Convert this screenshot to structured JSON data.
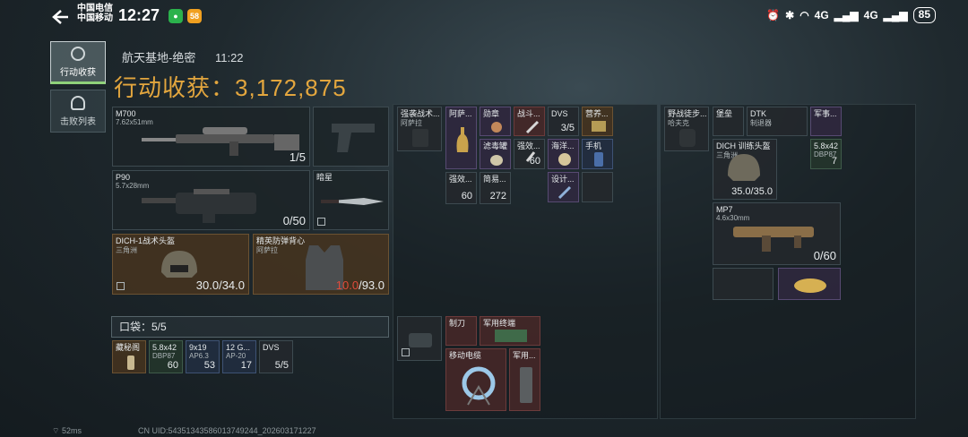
{
  "status": {
    "carrier_line1": "中国电信",
    "carrier_line2": "中国移动",
    "time": "12:27",
    "app_badge": "58",
    "network1": "4G",
    "network2": "4G",
    "battery": "85"
  },
  "nav": [
    {
      "label": "行动收获",
      "active": true
    },
    {
      "label": "击败列表",
      "active": false
    }
  ],
  "location": {
    "map": "航天基地-绝密",
    "duration": "11:22"
  },
  "headline": {
    "label": "行动收获：",
    "value": "3,172,875"
  },
  "weapons": [
    {
      "name": "M700",
      "caliber": "7.62x51mm",
      "count": "1/5"
    },
    {
      "name": "",
      "caliber": "",
      "count": ""
    },
    {
      "name": "P90",
      "caliber": "5.7x28mm",
      "count": "0/50"
    },
    {
      "name": "暗星",
      "caliber": "",
      "count": ""
    }
  ],
  "armor": [
    {
      "name": "DICH-1战术头盔",
      "maker": "三角洲",
      "durability": "30.0/34.0"
    },
    {
      "name": "精英防弹背心",
      "maker": "阿萨拉",
      "durability_current": "10.0",
      "durability_max": "/93.0"
    }
  ],
  "pocket": {
    "label": "口袋：5/5"
  },
  "pocket_items": [
    {
      "name": "藏秘阁",
      "sub": "",
      "count": ""
    },
    {
      "name": "5.8x42",
      "sub": "DBP87",
      "count": "60"
    },
    {
      "name": "9x19",
      "sub": "AP6.3",
      "count": "53"
    },
    {
      "name": "12 G...",
      "sub": "AP-20",
      "count": "17"
    },
    {
      "name": "DVS",
      "sub": "",
      "count": "5/5"
    }
  ],
  "chest_rig": {
    "name": "强袭战术...",
    "sub": "阿萨拉"
  },
  "rig_items": [
    {
      "name": "阿萨...",
      "count": ""
    },
    {
      "name": "勋章",
      "count": ""
    },
    {
      "name": "战斗...",
      "count": ""
    },
    {
      "name": "DVS",
      "count": "3/5"
    },
    {
      "name": "营养...",
      "count": ""
    },
    {
      "name": "滤毒罐",
      "count": ""
    },
    {
      "name": "强效...",
      "count": "60"
    },
    {
      "name": "海洋...",
      "count": ""
    },
    {
      "name": "手机",
      "count": ""
    },
    {
      "name": "设计...",
      "count": ""
    },
    {
      "name": "强效...",
      "count": "60"
    },
    {
      "name": "简易...",
      "count": "272"
    }
  ],
  "backpack_small": {
    "name": "",
    "count": ""
  },
  "backpack_items": [
    {
      "name": "制刀",
      "count": ""
    },
    {
      "name": "军用终端",
      "count": ""
    },
    {
      "name": "移动电缆",
      "count": ""
    },
    {
      "name": "军用...",
      "count": ""
    }
  ],
  "right_pack": {
    "name": "野战徒步...",
    "sub": "哈夫克"
  },
  "right_items": [
    {
      "name": "堡垒",
      "count": ""
    },
    {
      "name": "DTK",
      "sub": "制退器",
      "count": ""
    },
    {
      "name": "军事...",
      "count": ""
    },
    {
      "name": "DICH 训练头盔",
      "sub": "三角洲",
      "count": "35.0/35.0"
    },
    {
      "name": "5.8x42",
      "sub": "DBP87",
      "count": "7"
    },
    {
      "name": "MP7",
      "sub": "4.6x30mm",
      "count": "0/60"
    },
    {
      "name": "",
      "count": ""
    }
  ],
  "footer": {
    "ping": "52ms",
    "uid": "CN UID:54351343586013749244_202603171227"
  }
}
